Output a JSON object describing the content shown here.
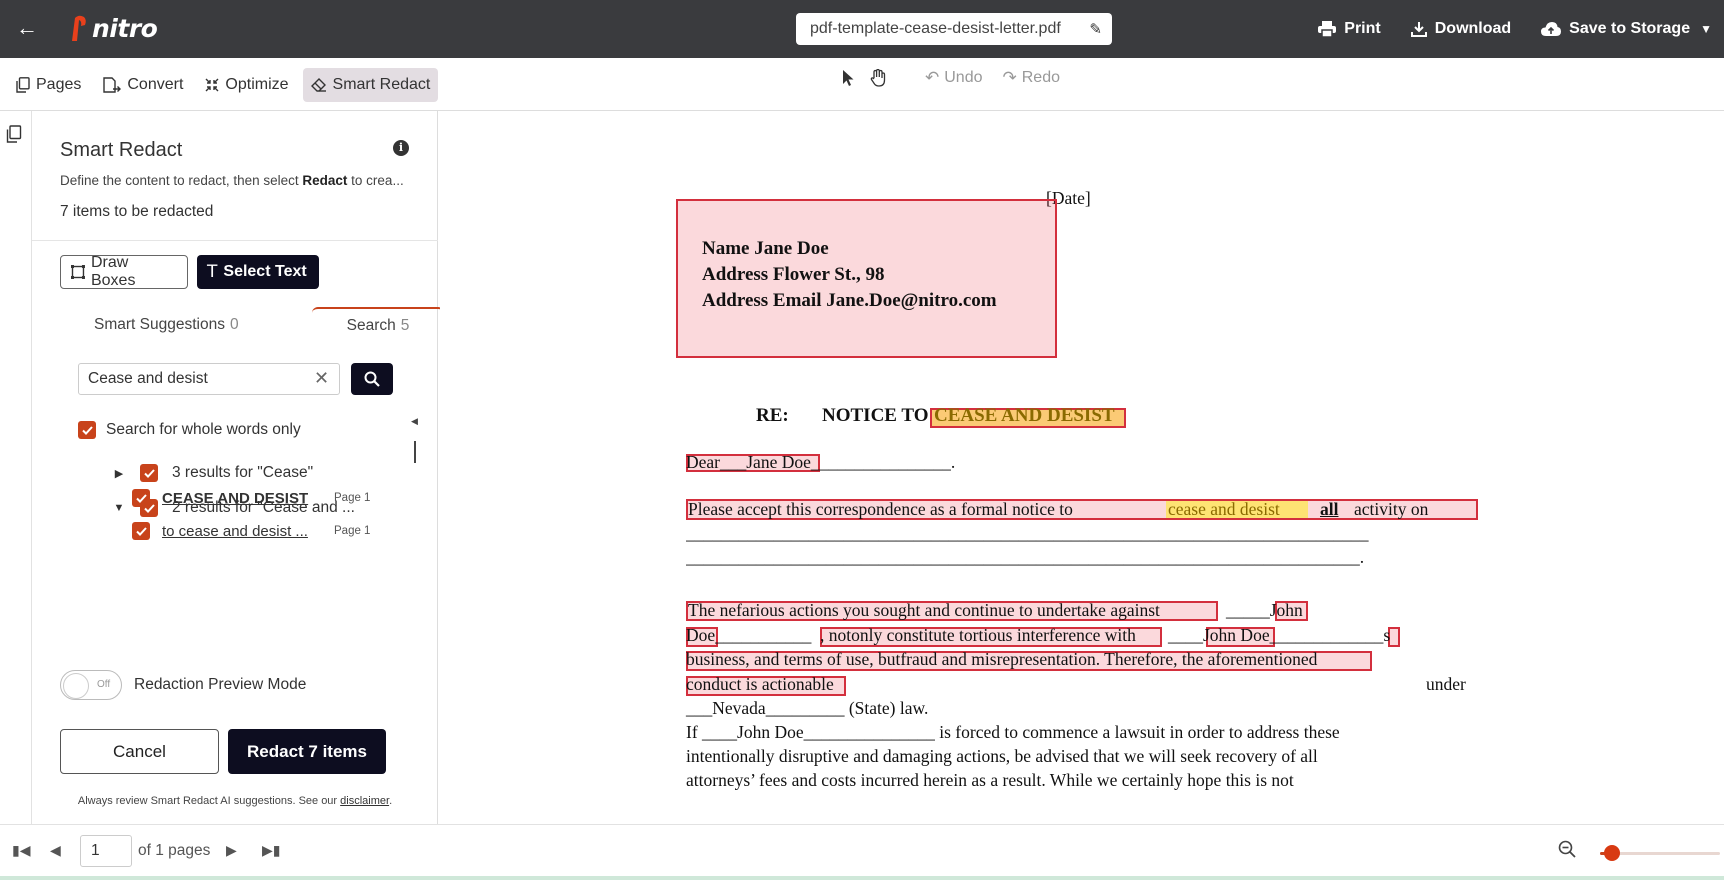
{
  "app": {
    "logo_text": "nitro",
    "brand_color": "#e8401c"
  },
  "header": {
    "filename": "pdf-template-cease-desist-letter.pdf",
    "print_label": "Print",
    "download_label": "Download",
    "save_label": "Save to Storage"
  },
  "toolbar": {
    "pages": "Pages",
    "convert": "Convert",
    "optimize": "Optimize",
    "smart_redact": "Smart Redact",
    "undo": "Undo",
    "redo": "Redo"
  },
  "panel": {
    "title": "Smart Redact",
    "desc_prefix": "Define the content to redact, then select ",
    "desc_bold": "Redact",
    "desc_suffix": " to crea...",
    "count": "7 items to be redacted",
    "draw_boxes": "Draw Boxes",
    "select_text": "Select Text",
    "tab_suggestions": "Smart Suggestions",
    "tab_suggestions_count": "0",
    "tab_search": "Search",
    "tab_search_count": "5",
    "search_value": "Cease and desist",
    "whole_words": "Search for whole words only",
    "results": [
      {
        "label": "3 results for \"Cease\"",
        "expanded": false
      },
      {
        "label": "2 results for \"Cease and ...",
        "expanded": true
      }
    ],
    "sub_results": [
      {
        "text": "CEASE AND DESIST",
        "page": "Page 1"
      },
      {
        "text": "to cease and desist ...",
        "page": "Page 1"
      }
    ],
    "preview_off": "Off",
    "preview_label": "Redaction Preview Mode",
    "cancel": "Cancel",
    "redact": "Redact 7 items",
    "disclaimer_prefix": "Always review Smart Redact AI suggestions. See our ",
    "disclaimer_link": "disclaimer",
    "disclaimer_suffix": "."
  },
  "document": {
    "date": "[Date]",
    "addr1": "Name Jane Doe",
    "addr2": "Address Flower St., 98",
    "addr3": "Address Email Jane.Doe@nitro.com",
    "re": "RE:",
    "notice": "NOTICE TO",
    "notice_highlight": "CEASE AND DESIST",
    "dear": "Dear___Jane Doe________________.",
    "p1_a": "Please  accept  this  correspondence  as  a  formal  notice  to",
    "p1_hl": "cease  and  desist",
    "p1_b": "all",
    "p1_c": "activity  on",
    "p1_line2": "______________________________________________________________________________",
    "p1_line3": "_____________________________________________________________________________.",
    "p2_l1a": "The  nefarious  actions  you  sought  and  continue  to  undertake  against",
    "p2_l1b": "_____John",
    "p2_l2a": "Doe___________",
    "p2_l2b": ", notonly constitute tortious interference with",
    "p2_l2c": "____John Doe_____________s",
    "p2_l3": "business, and terms of use, butfraud and misrepresentation. Therefore, the aforementioned",
    "p2_l4a": "conduct is actionable",
    "p2_l4b": "under",
    "p2_l5": "___Nevada_________ (State) law.",
    "p3_l1": "If ____John Doe_______________ is forced to commence a lawsuit in order to address these",
    "p3_l2": "intentionally disruptive and damaging actions, be advised that we will seek recovery of all",
    "p3_l3": "attorneys’ fees and costs incurred herein as a result. While we certainly hope this is not"
  },
  "footer": {
    "page_value": "1",
    "of_pages": "of 1 pages",
    "zoom_level": 0.1
  }
}
